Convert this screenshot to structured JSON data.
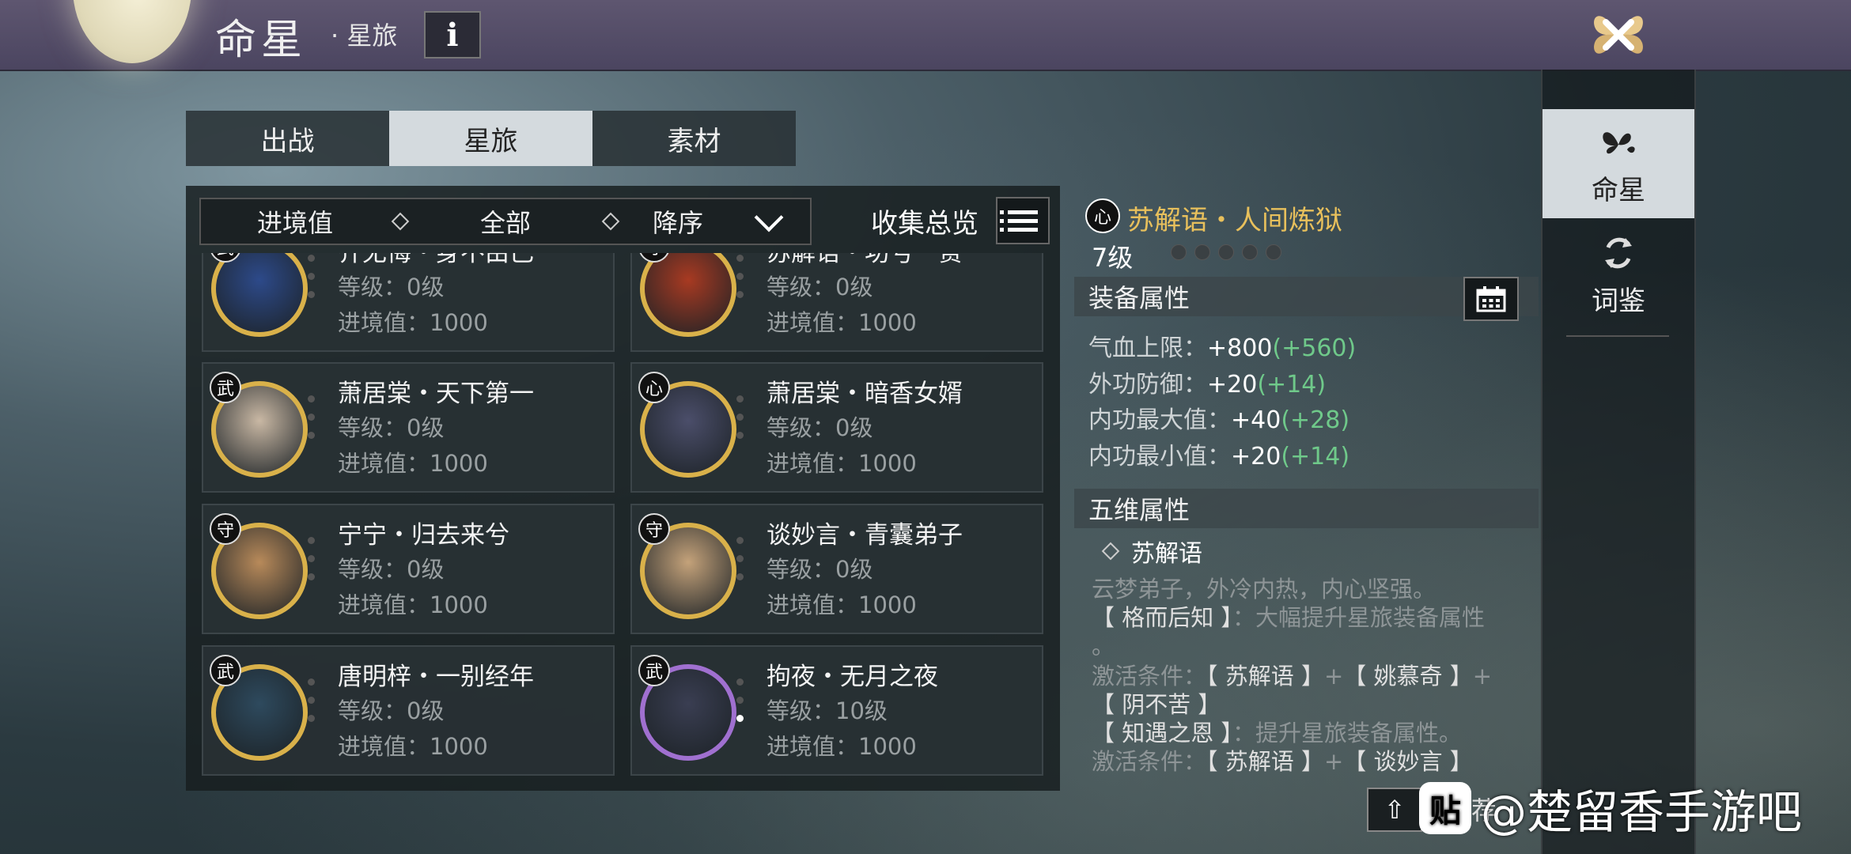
{
  "header": {
    "title": "命星",
    "subtitle": "· 星旅",
    "info_label": "i"
  },
  "tabs": [
    {
      "label": "出战",
      "active": false
    },
    {
      "label": "星旅",
      "active": true
    },
    {
      "label": "素材",
      "active": false
    }
  ],
  "filters": {
    "sort_by": "进境值",
    "category": "全部",
    "order": "降序",
    "collect_label": "收集总览"
  },
  "cards": [
    {
      "tag": "武",
      "name": "齐无悔・身不由己",
      "level": "等级：0级",
      "progress": "进境值：1000",
      "frame": "gold",
      "avatar_color": "#2d4a8a"
    },
    {
      "tag": "守",
      "name": "苏解语・功亏一篑",
      "level": "等级：0级",
      "progress": "进境值：1000",
      "frame": "gold",
      "avatar_color": "#a83a22"
    },
    {
      "tag": "武",
      "name": "萧居棠・天下第一",
      "level": "等级：0级",
      "progress": "进境值：1000",
      "frame": "gold",
      "avatar_color": "#c9b8a4"
    },
    {
      "tag": "心",
      "name": "萧居棠・暗香女婿",
      "level": "等级：0级",
      "progress": "进境值：1000",
      "frame": "gold",
      "avatar_color": "#4b4e6a"
    },
    {
      "tag": "守",
      "name": "宁宁・归去来兮",
      "level": "等级：0级",
      "progress": "进境值：1000",
      "frame": "gold",
      "avatar_color": "#b88a5a"
    },
    {
      "tag": "守",
      "name": "谈妙言・青囊弟子",
      "level": "等级：0级",
      "progress": "进境值：1000",
      "frame": "gold",
      "avatar_color": "#c4a27a"
    },
    {
      "tag": "武",
      "name": "唐明梓・一别经年",
      "level": "等级：0级",
      "progress": "进境值：1000",
      "frame": "gold",
      "avatar_color": "#2e4a5e"
    },
    {
      "tag": "武",
      "name": "拘夜・无月之夜",
      "level": "等级：10级",
      "progress": "进境值：1000",
      "frame": "purple",
      "avatar_color": "#3a3e52"
    }
  ],
  "detail": {
    "tag": "心",
    "name": "苏解语・人间炼狱",
    "level": "7级",
    "equip_header": "装备属性",
    "attributes": [
      {
        "label": "气血上限：",
        "value": "+800",
        "bonus": "(+560)"
      },
      {
        "label": "外功防御：",
        "value": "+20",
        "bonus": "(+14)"
      },
      {
        "label": "内功最大值：",
        "value": "+40",
        "bonus": "(+28)"
      },
      {
        "label": "内功最小值：",
        "value": "+20",
        "bonus": "(+14)"
      }
    ],
    "five_header": "五维属性",
    "set_name": "苏解语",
    "desc1": "云梦弟子，外冷内热，内心坚强。",
    "skill1": "【 格而后知 】",
    "skill1_desc": "：大幅提升星旅装备属性",
    "dot": "。",
    "cond_label": "激活条件：",
    "cond1a": "【 苏解语 】",
    "cond1b": "【 姚慕奇 】",
    "cond1c": "【 阴不苦 】",
    "plus": "+",
    "skill2": "【 知遇之恩 】",
    "skill2_desc": "：提升星旅装备属性。",
    "cond2a": "【 苏解语 】",
    "cond2b": "【 谈妙言 】"
  },
  "sidenav": [
    {
      "label": "命星",
      "icon": "butterfly-icon",
      "active": true
    },
    {
      "label": "词鉴",
      "icon": "cycle-icon",
      "active": false
    }
  ],
  "bottom": {
    "up_label": "⇧",
    "recommend": "推荐"
  },
  "watermark": {
    "logo": "贴",
    "text": "@楚留香手游吧"
  }
}
